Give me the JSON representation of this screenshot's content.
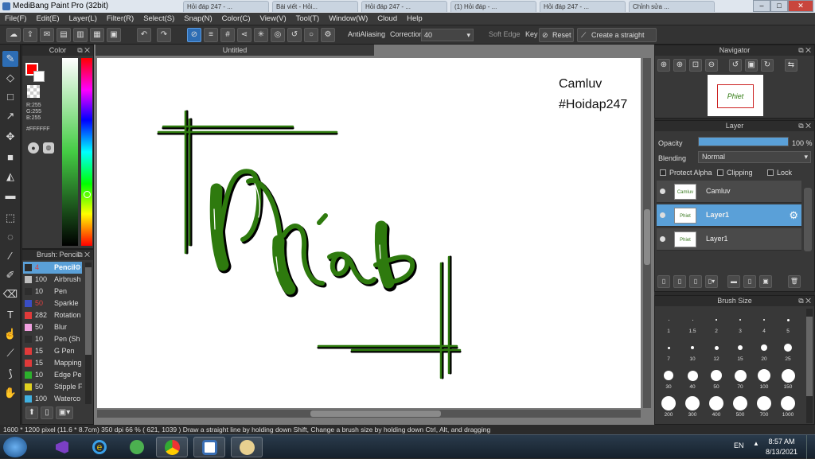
{
  "app": {
    "title": "MediBang Paint Pro (32bit)"
  },
  "browser_tabs": [
    "Hỏi đáp 247 - ...",
    "Bài viết - Hỏi...",
    "Hỏi đáp 247 - ...",
    "(1) Hỏi đáp - ...",
    "Hỏi đáp 247 - ...",
    "Chỉnh sửa ..."
  ],
  "menu": [
    "File(F)",
    "Edit(E)",
    "Layer(L)",
    "Filter(R)",
    "Select(S)",
    "Snap(N)",
    "Color(C)",
    "View(V)",
    "Tool(T)",
    "Window(W)",
    "Cloud",
    "Help"
  ],
  "toolbar": {
    "antialias": "AntiAliasing",
    "correction": "Correction",
    "correction_value": "40",
    "soft_edge": "Soft Edge",
    "key": "Key",
    "reset": "Reset",
    "straight": "Create a straight line"
  },
  "color_panel": {
    "title": "Color",
    "r": "R:255",
    "g": "G:255",
    "b": "B:255",
    "hex": "#FFFFFF",
    "primary": "#ff0000"
  },
  "canvas": {
    "tab": "Untitled",
    "text1": "Camluv",
    "text2": "#Hoidap247",
    "stroke_color": "#2e7a0e"
  },
  "brush_panel": {
    "title": "Brush: Pencil",
    "items": [
      {
        "size": "4",
        "name": "Pencil",
        "color": "#2d2d2d",
        "selected": true
      },
      {
        "size": "100",
        "name": "Airbrush",
        "color": "#bdbdbd"
      },
      {
        "size": "10",
        "name": "Pen",
        "color": "#2d2d2d"
      },
      {
        "size": "50",
        "name": "Sparkle",
        "color": "#3a4ec4"
      },
      {
        "size": "282",
        "name": "Rotation",
        "color": "#e03a3a"
      },
      {
        "size": "50",
        "name": "Blur",
        "color": "#f0a0e0"
      },
      {
        "size": "10",
        "name": "Pen (Sh",
        "color": "#2d2d2d"
      },
      {
        "size": "15",
        "name": "G Pen",
        "color": "#e03a3a"
      },
      {
        "size": "15",
        "name": "Mapping",
        "color": "#e03a3a"
      },
      {
        "size": "10",
        "name": "Edge Pe",
        "color": "#2cb02c"
      },
      {
        "size": "50",
        "name": "Stipple F",
        "color": "#e0d020"
      },
      {
        "size": "100",
        "name": "Waterco",
        "color": "#40b0e0"
      }
    ]
  },
  "navigator": {
    "title": "Navigator"
  },
  "layer_panel": {
    "title": "Layer",
    "opacity_label": "Opacity",
    "opacity_value": "100 %",
    "opacity_pct": 100,
    "blending_label": "Blending",
    "blending_value": "Normal",
    "protect_alpha": "Protect Alpha",
    "clipping": "Clipping",
    "lock": "Lock",
    "layers": [
      {
        "name": "Camluv",
        "thumb": "Camluv #Hoidap247",
        "selected": false
      },
      {
        "name": "Layer1",
        "thumb": "Phiet",
        "selected": true
      },
      {
        "name": "Layer1",
        "thumb": "Phiet",
        "selected": false
      }
    ]
  },
  "brush_size": {
    "title": "Brush Size",
    "sizes": [
      "1",
      "1.5",
      "2",
      "3",
      "4",
      "5",
      "7",
      "10",
      "12",
      "15",
      "20",
      "25",
      "30",
      "40",
      "50",
      "70",
      "100",
      "150",
      "200",
      "300",
      "400",
      "500",
      "700",
      "1000"
    ]
  },
  "status": {
    "text": "1600 * 1200 pixel   (11.6 * 8.7cm)   350 dpi   66 %   ( 621, 1039 )   Draw a straight line by holding down Shift, Change a brush size by holding down Ctrl, Alt, and dragging"
  },
  "taskbar": {
    "lang": "EN",
    "time": "8:57 AM",
    "date": "8/13/2021"
  }
}
